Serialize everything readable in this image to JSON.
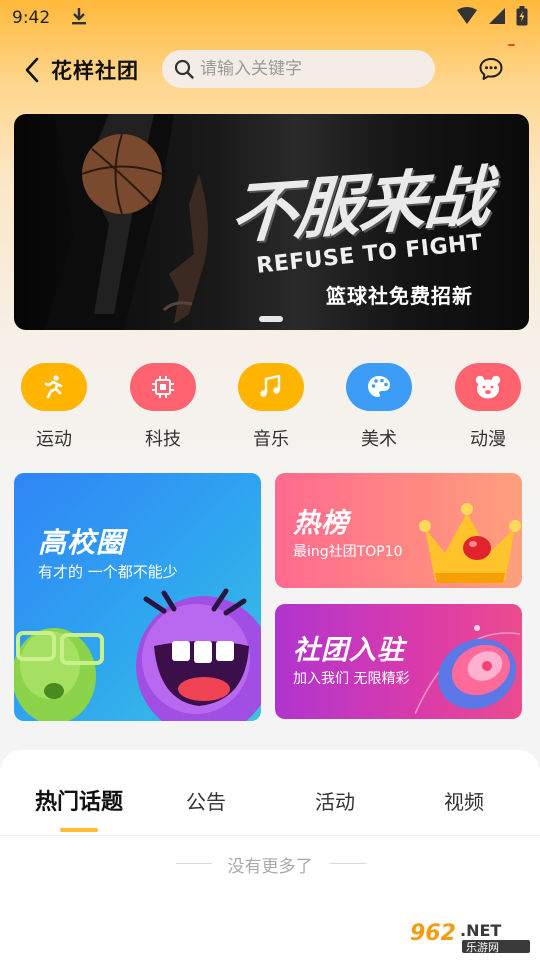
{
  "status_bar": {
    "time": "9:42"
  },
  "header": {
    "title": "花样社团",
    "search_placeholder": "请输入关键字"
  },
  "banner": {
    "heading": "不服来战",
    "subtitle_en": "REFUSE TO FIGHT",
    "subtitle_cn": "篮球社免费招新"
  },
  "categories": [
    {
      "label": "运动",
      "icon": "running-icon",
      "color": "#ffb400"
    },
    {
      "label": "科技",
      "icon": "chip-icon",
      "color": "#ff6370"
    },
    {
      "label": "音乐",
      "icon": "music-note-icon",
      "color": "#ffb400"
    },
    {
      "label": "美术",
      "icon": "palette-icon",
      "color": "#3d9cf5"
    },
    {
      "label": "动漫",
      "icon": "bear-icon",
      "color": "#ff6370"
    }
  ],
  "cards": {
    "campus": {
      "title": "高校圈",
      "subtitle": "有才的 一个都不能少"
    },
    "hot": {
      "title": "热榜",
      "subtitle": "最ing社团TOP10"
    },
    "join": {
      "title": "社团入驻",
      "subtitle": "加入我们 无限精彩"
    }
  },
  "tabs": [
    {
      "label": "热门话题",
      "active": true
    },
    {
      "label": "公告",
      "active": false
    },
    {
      "label": "活动",
      "active": false
    },
    {
      "label": "视频",
      "active": false
    }
  ],
  "empty_text": "没有更多了",
  "watermark": {
    "main": "962.NET",
    "sub": "乐游网"
  }
}
